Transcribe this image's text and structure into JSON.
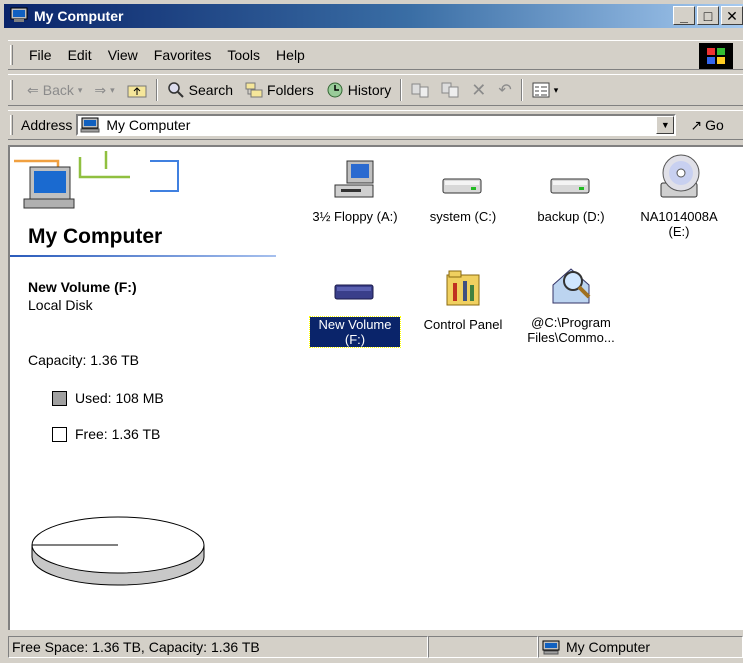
{
  "window": {
    "title": "My Computer"
  },
  "menu": {
    "items": [
      "File",
      "Edit",
      "View",
      "Favorites",
      "Tools",
      "Help"
    ]
  },
  "toolbar": {
    "back": "Back",
    "search": "Search",
    "folders": "Folders",
    "history": "History"
  },
  "address": {
    "label": "Address",
    "value": "My Computer",
    "go": "Go"
  },
  "panel": {
    "title": "My Computer",
    "selected_name": "New Volume (F:)",
    "selected_type": "Local Disk",
    "capacity": "Capacity: 1.36 TB",
    "used": "Used: 108 MB",
    "free": "Free: 1.36 TB",
    "used_fraction": 0.0001
  },
  "drives": [
    {
      "name": "3½ Floppy (A:)",
      "icon": "floppy-drive-icon"
    },
    {
      "name": "system (C:)",
      "icon": "hard-drive-icon"
    },
    {
      "name": "backup (D:)",
      "icon": "hard-drive-icon"
    },
    {
      "name": "NA1014008A (E:)",
      "icon": "cd-drive-icon"
    },
    {
      "name": "New Volume (F:)",
      "icon": "hard-drive-icon",
      "selected": true
    },
    {
      "name": "Control Panel",
      "icon": "control-panel-icon"
    },
    {
      "name": "@C:\\Program Files\\Commo...",
      "icon": "search-folder-icon"
    }
  ],
  "status": {
    "text": "Free Space: 1.36 TB, Capacity: 1.36 TB",
    "zone": "My Computer"
  },
  "colors": {
    "titlebar_start": "#0a246a",
    "titlebar_end": "#a6caf0",
    "selection": "#0a246a"
  }
}
